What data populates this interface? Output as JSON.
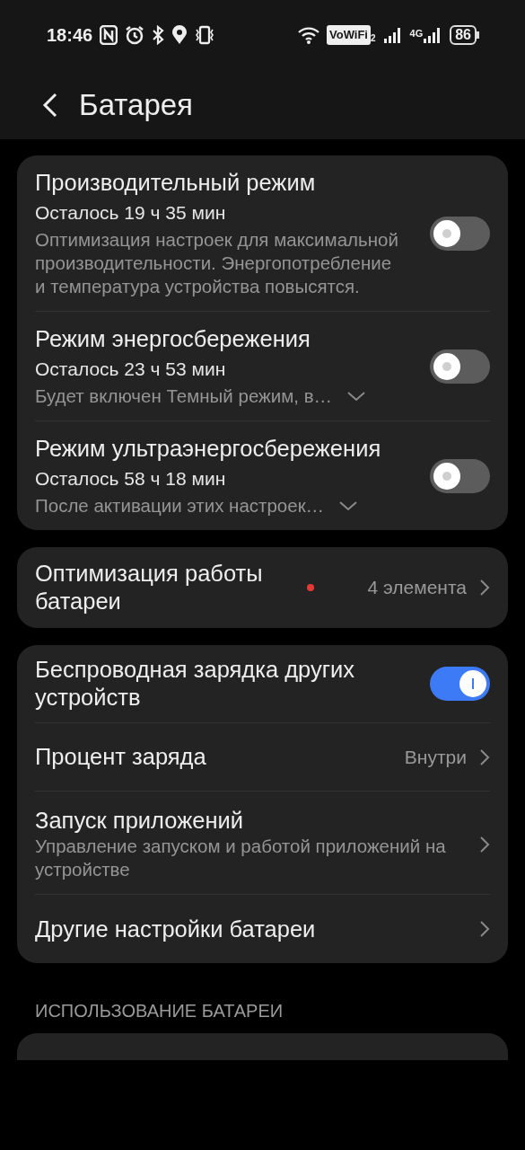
{
  "status_bar": {
    "time": "18:46",
    "vowifi": "VoWiFi",
    "vowifi_sim": "2",
    "network": "4G",
    "battery": "86"
  },
  "header": {
    "title": "Батарея"
  },
  "groups": [
    {
      "items": [
        {
          "kind": "toggle",
          "title": "Производительный режим",
          "subtitle": "Осталось 19 ч 35 мин",
          "description": "Оптимизация настроек для максимальной производительности. Энергопотребление и температура устройства повысятся.",
          "on": false
        },
        {
          "kind": "toggle",
          "title": "Режим энергосбережения",
          "subtitle": "Осталось 23 ч 53 мин",
          "description": "Будет включен Темный режим, в…",
          "expandable": true,
          "on": false
        },
        {
          "kind": "toggle",
          "title": "Режим ультраэнергосбережения",
          "subtitle": "Осталось 58 ч 18 мин",
          "description": "После активации этих настроек…",
          "expandable": true,
          "on": false
        }
      ]
    },
    {
      "items": [
        {
          "kind": "link",
          "title": "Оптимизация работы батареи",
          "badge_dot": true,
          "value": "4 элемента"
        }
      ]
    },
    {
      "items": [
        {
          "kind": "toggle",
          "title": "Беспроводная зарядка других устройств",
          "on": true
        },
        {
          "kind": "link",
          "title": "Процент заряда",
          "value": "Внутри"
        },
        {
          "kind": "link",
          "title": "Запуск приложений",
          "description": "Управление запуском и работой приложений на устройстве"
        },
        {
          "kind": "link",
          "title": "Другие настройки батареи"
        }
      ]
    }
  ],
  "section": {
    "title": "ИСПОЛЬЗОВАНИЕ БАТАРЕИ"
  }
}
